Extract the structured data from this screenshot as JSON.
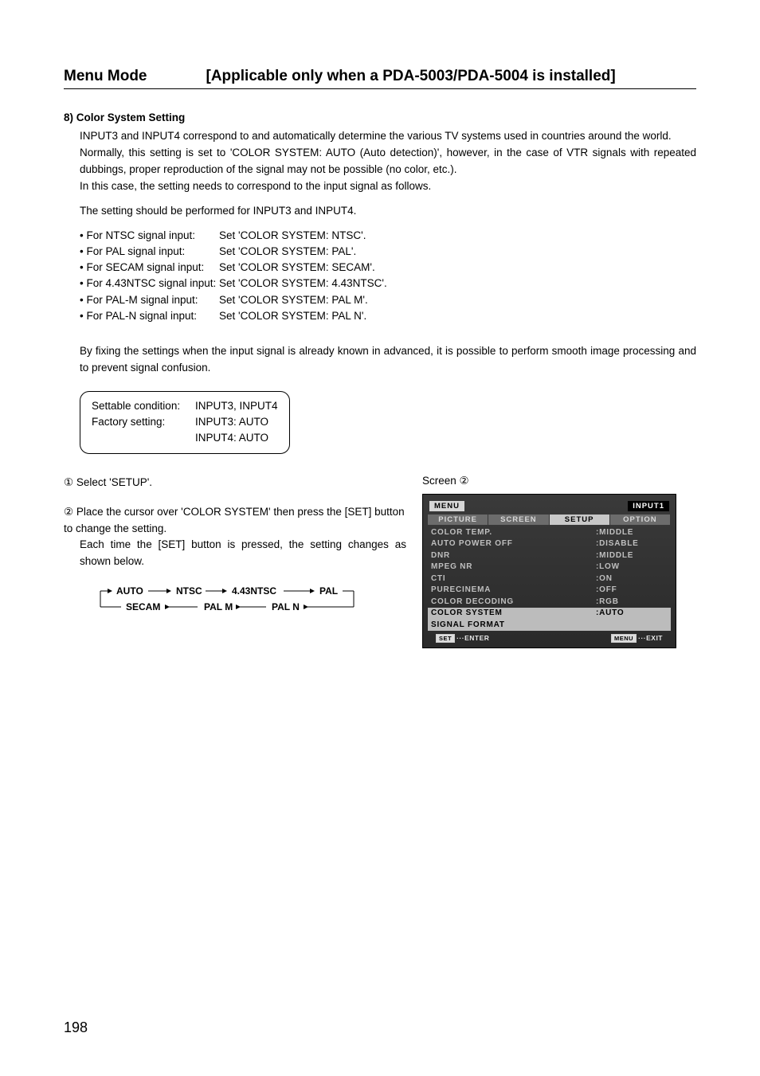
{
  "header": {
    "left": "Menu Mode",
    "right": "[Applicable only when a PDA-5003/PDA-5004 is installed]"
  },
  "section": {
    "number_heading": "8) Color System Setting",
    "p1": "INPUT3 and INPUT4 correspond to and automatically determine the various TV systems used in countries around the world.",
    "p2": " Normally, this setting is set to 'COLOR SYSTEM: AUTO (Auto detection)', however, in the case of VTR signals with repeated dubbings, proper reproduction of the signal may not be possible (no color, etc.).",
    "p3": "In this case, the setting needs to correspond to the input signal as follows.",
    "p4": "The setting should be performed for INPUT3 and INPUT4.",
    "settings": [
      {
        "label": "• For NTSC signal input:",
        "value": "Set 'COLOR SYSTEM: NTSC'."
      },
      {
        "label": "• For PAL signal input:",
        "value": "Set 'COLOR SYSTEM: PAL'."
      },
      {
        "label": "• For SECAM signal input:",
        "value": "Set 'COLOR SYSTEM: SECAM'."
      },
      {
        "label": "• For 4.43NTSC signal input:",
        "value": "Set 'COLOR SYSTEM: 4.43NTSC'."
      },
      {
        "label": "• For PAL-M signal input:",
        "value": "Set 'COLOR SYSTEM: PAL M'."
      },
      {
        "label": "• For PAL-N signal input:",
        "value": "Set 'COLOR SYSTEM: PAL N'."
      }
    ],
    "conclude": "By fixing the settings when the input signal is already known in advanced, it is possible to perform smooth image processing and to prevent signal confusion.",
    "box": {
      "rows": [
        {
          "label": "Settable condition:",
          "value": "INPUT3, INPUT4"
        },
        {
          "label": "Factory setting:",
          "value": "INPUT3: AUTO"
        },
        {
          "label": "",
          "value": "INPUT4: AUTO"
        }
      ]
    }
  },
  "steps": {
    "s1_num": "①",
    "s1_text": " Select 'SETUP'.",
    "s2_num": "②",
    "s2_text": " Place the cursor over 'COLOR SYSTEM' then press the [SET] button to change the setting.",
    "s2_sub": "Each time the [SET] button is pressed, the setting changes as shown below.",
    "cycle": {
      "nodes_top": [
        "AUTO",
        "NTSC",
        "4.43NTSC",
        "PAL"
      ],
      "nodes_bottom": [
        "SECAM",
        "PAL M",
        "PAL N"
      ]
    }
  },
  "screen": {
    "label": "Screen ②",
    "osd": {
      "title_left": "MENU",
      "title_right": "INPUT1",
      "tabs": [
        "PICTURE",
        "SCREEN",
        "SETUP",
        "OPTION"
      ],
      "active_tab_index": 2,
      "items": [
        {
          "l": "COLOR TEMP.",
          "r": ":MIDDLE",
          "hl": false
        },
        {
          "l": "AUTO POWER OFF",
          "r": ":DISABLE",
          "hl": false
        },
        {
          "l": "DNR",
          "r": ":MIDDLE",
          "hl": false
        },
        {
          "l": "MPEG NR",
          "r": ":LOW",
          "hl": false
        },
        {
          "l": "CTI",
          "r": ":ON",
          "hl": false
        },
        {
          "l": "PURECINEMA",
          "r": ":OFF",
          "hl": false
        },
        {
          "l": "COLOR DECODING",
          "r": ":RGB",
          "hl": false
        },
        {
          "l": "COLOR SYSTEM",
          "r": ":AUTO",
          "hl": true
        },
        {
          "l": "SIGNAL FORMAT",
          "r": "",
          "hl": "gray"
        }
      ],
      "foot_left_key": "SET",
      "foot_left_text": "···ENTER",
      "foot_right_key": "MENU",
      "foot_right_text": "···EXIT"
    }
  },
  "page_number": "198"
}
